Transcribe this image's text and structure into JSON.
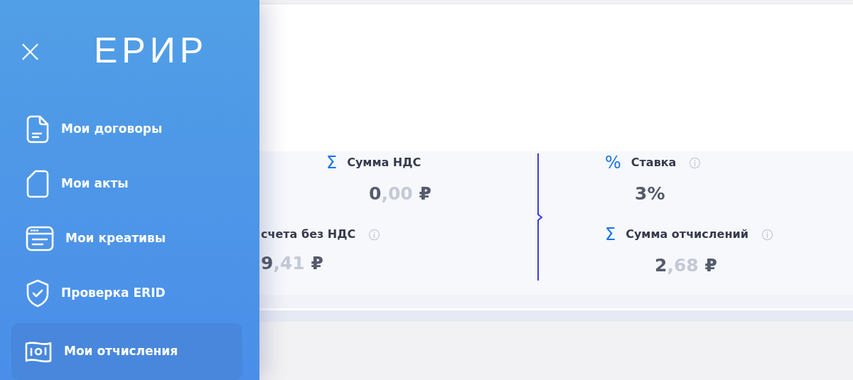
{
  "sidebar": {
    "close": "×",
    "logo": "ЕРИР",
    "items": [
      {
        "kind": "contract",
        "label": "Мои договоры",
        "selected": false
      },
      {
        "kind": "act",
        "label": "Мои акты",
        "selected": false
      },
      {
        "kind": "creative",
        "label": "Мои креативы",
        "selected": false
      },
      {
        "kind": "check",
        "label": "Проверка ERID",
        "selected": false
      },
      {
        "kind": "payout",
        "label": "Мои отчисления",
        "selected": true
      }
    ]
  },
  "summary": {
    "left": [
      {
        "icon": "Σ",
        "label": "Сумма НДС",
        "info": false,
        "whole": "0",
        "fraction": ",00",
        "currency": "₽"
      },
      {
        "label": "счета без НДС",
        "info": true,
        "whole": "9",
        "fraction": ",41",
        "currency": "₽"
      }
    ],
    "right": [
      {
        "icon": "%",
        "label": "Ставка",
        "info": true,
        "value": "3%"
      },
      {
        "icon": "Σ",
        "label": "Сумма отчислений",
        "info": true,
        "whole": "2",
        "fraction": ",68",
        "currency": "₽"
      }
    ]
  }
}
